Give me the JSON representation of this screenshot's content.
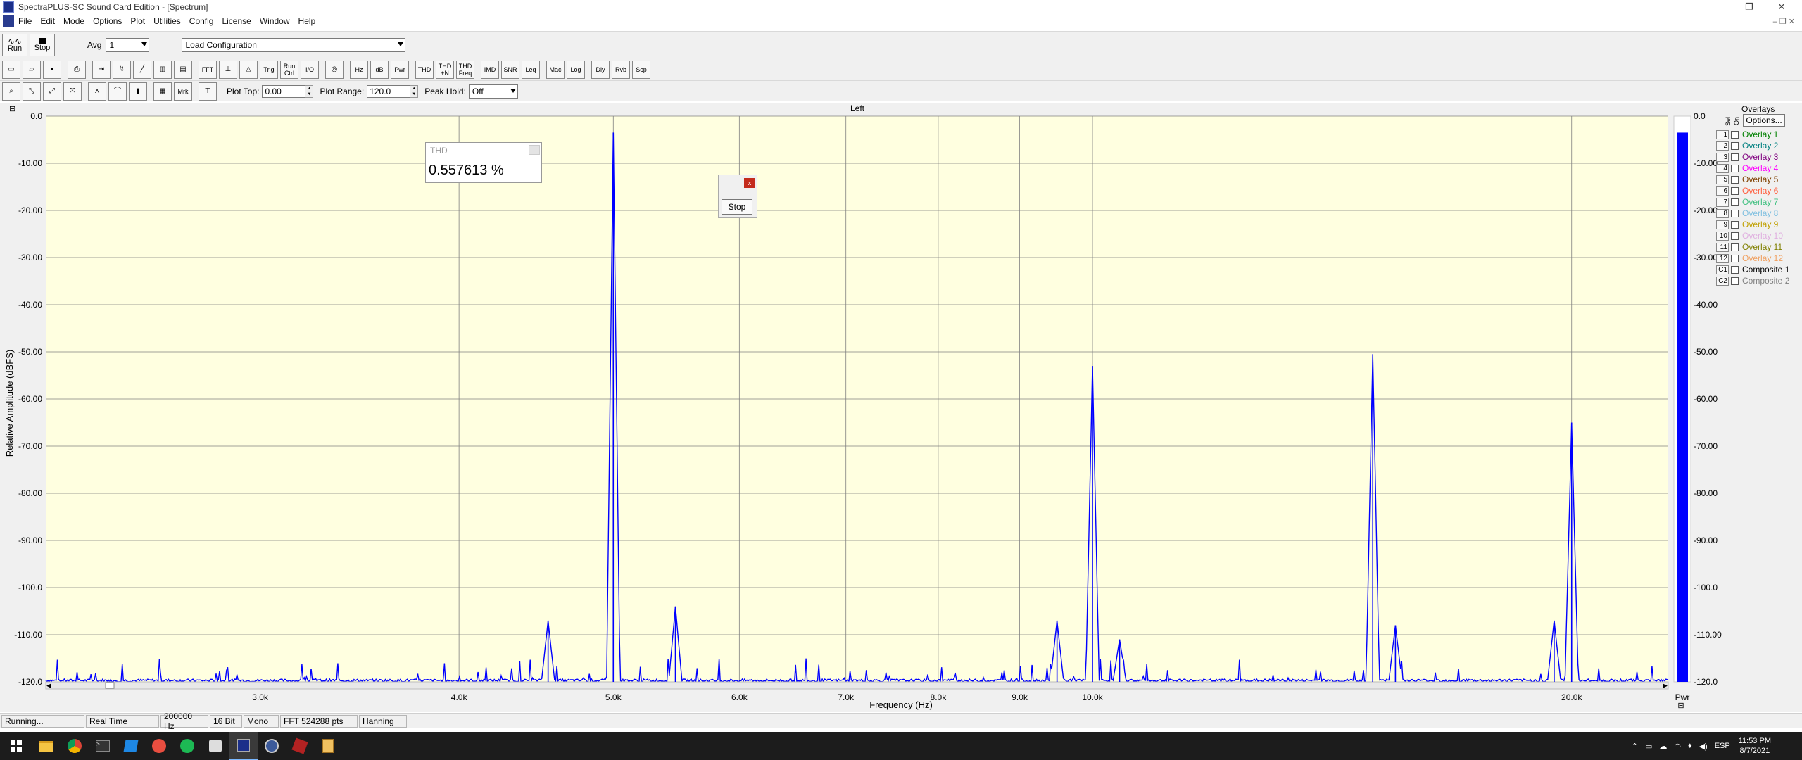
{
  "window": {
    "title": "SpectraPLUS-SC Sound Card Edition - [Spectrum]",
    "minimize": "–",
    "restore": "❐",
    "close": "✕"
  },
  "menu": [
    "File",
    "Edit",
    "Mode",
    "Options",
    "Plot",
    "Utilities",
    "Config",
    "License",
    "Window",
    "Help"
  ],
  "toolbar1": {
    "run_label": "Run",
    "stop_label": "Stop",
    "avg_label": "Avg",
    "avg_value": "1",
    "config_value": "Load Configuration"
  },
  "toolbar2": {
    "buttons": [
      "FFT",
      "Trig",
      "Run Ctrl",
      "I/O",
      "Hz",
      "dB",
      "Pwr",
      "THD",
      "THD +N",
      "THD Freq",
      "IMD",
      "SNR",
      "Leq",
      "Mac",
      "Log",
      "Dly",
      "Rvb",
      "Scp"
    ]
  },
  "toolbar3": {
    "buttons": [
      "Mrk"
    ],
    "plot_top_label": "Plot Top:",
    "plot_top_value": "0.00",
    "plot_range_label": "Plot Range:",
    "plot_range_value": "120.0",
    "peak_hold_label": "Peak Hold:",
    "peak_hold_value": "Off"
  },
  "plot": {
    "channel_title": "Left",
    "x_label": "Frequency (Hz)",
    "y_label": "Relative Amplitude (dBFS)",
    "y_ticks": [
      "0.0",
      "-10.00",
      "-20.00",
      "-30.00",
      "-40.00",
      "-50.00",
      "-60.00",
      "-70.00",
      "-80.00",
      "-90.00",
      "-100.0",
      "-110.00",
      "-120.0"
    ],
    "x_ticks": [
      "3.0k",
      "4.0k",
      "5.0k",
      "6.0k",
      "7.0k",
      "8.0k",
      "9.0k",
      "10.0k",
      "20.0k"
    ],
    "pwr_label": "Pwr",
    "pwr_ticks": [
      "0.0",
      "-10.00",
      "-20.00",
      "-30.00",
      "-40.00",
      "-50.00",
      "-60.00",
      "-70.00",
      "-80.00",
      "-90.00",
      "-100.0",
      "-110.00",
      "-120.0"
    ],
    "colors": {
      "bg": "#ffffe0",
      "trace": "#0000ff",
      "grid": "#808080",
      "pwr": "#0000ff"
    }
  },
  "chart_data": {
    "type": "line",
    "title": "Left",
    "xlabel": "Frequency (Hz)",
    "ylabel": "Relative Amplitude (dBFS)",
    "x_scale": "log",
    "xlim": [
      2200,
      23000
    ],
    "ylim": [
      -120,
      0
    ],
    "grid": true,
    "peaks": [
      {
        "x": 5000,
        "y": -3.5
      },
      {
        "x": 5470,
        "y": -104
      },
      {
        "x": 4550,
        "y": -107
      },
      {
        "x": 9500,
        "y": -107
      },
      {
        "x": 10000,
        "y": -53
      },
      {
        "x": 10400,
        "y": -111
      },
      {
        "x": 15000,
        "y": -50.5
      },
      {
        "x": 15500,
        "y": -108
      },
      {
        "x": 19500,
        "y": -107
      },
      {
        "x": 20000,
        "y": -65
      }
    ],
    "pwr_value": -3.5
  },
  "overlays": {
    "header": "Overlays",
    "sel_label": "Sel",
    "on_label": "On",
    "options_label": "Options...",
    "items": [
      {
        "num": "1",
        "label": "Overlay 1",
        "color": "#008000"
      },
      {
        "num": "2",
        "label": "Overlay 2",
        "color": "#008080"
      },
      {
        "num": "3",
        "label": "Overlay 3",
        "color": "#800080"
      },
      {
        "num": "4",
        "label": "Overlay 4",
        "color": "#ff00ff"
      },
      {
        "num": "5",
        "label": "Overlay 5",
        "color": "#804000"
      },
      {
        "num": "6",
        "label": "Overlay 6",
        "color": "#ff6040"
      },
      {
        "num": "7",
        "label": "Overlay 7",
        "color": "#40c080"
      },
      {
        "num": "8",
        "label": "Overlay 8",
        "color": "#80c0e0"
      },
      {
        "num": "9",
        "label": "Overlay 9",
        "color": "#c0a000"
      },
      {
        "num": "10",
        "label": "Overlay 10",
        "color": "#e0b0e0"
      },
      {
        "num": "11",
        "label": "Overlay 11",
        "color": "#808000"
      },
      {
        "num": "12",
        "label": "Overlay 12",
        "color": "#f0a060"
      },
      {
        "num": "C1",
        "label": "Composite 1",
        "color": "#000000"
      },
      {
        "num": "C2",
        "label": "Composite 2",
        "color": "#808080"
      }
    ]
  },
  "thd_window": {
    "title": "THD",
    "value": "0.557613 %"
  },
  "stop_dialog": {
    "button": "Stop",
    "close": "x"
  },
  "status": [
    "Running...",
    "Real Time",
    "200000 Hz",
    "16 Bit",
    "Mono",
    "FFT 524288 pts",
    "Hanning"
  ],
  "tray": {
    "lang": "ESP",
    "time": "11:53 PM",
    "date": "8/7/2021"
  }
}
